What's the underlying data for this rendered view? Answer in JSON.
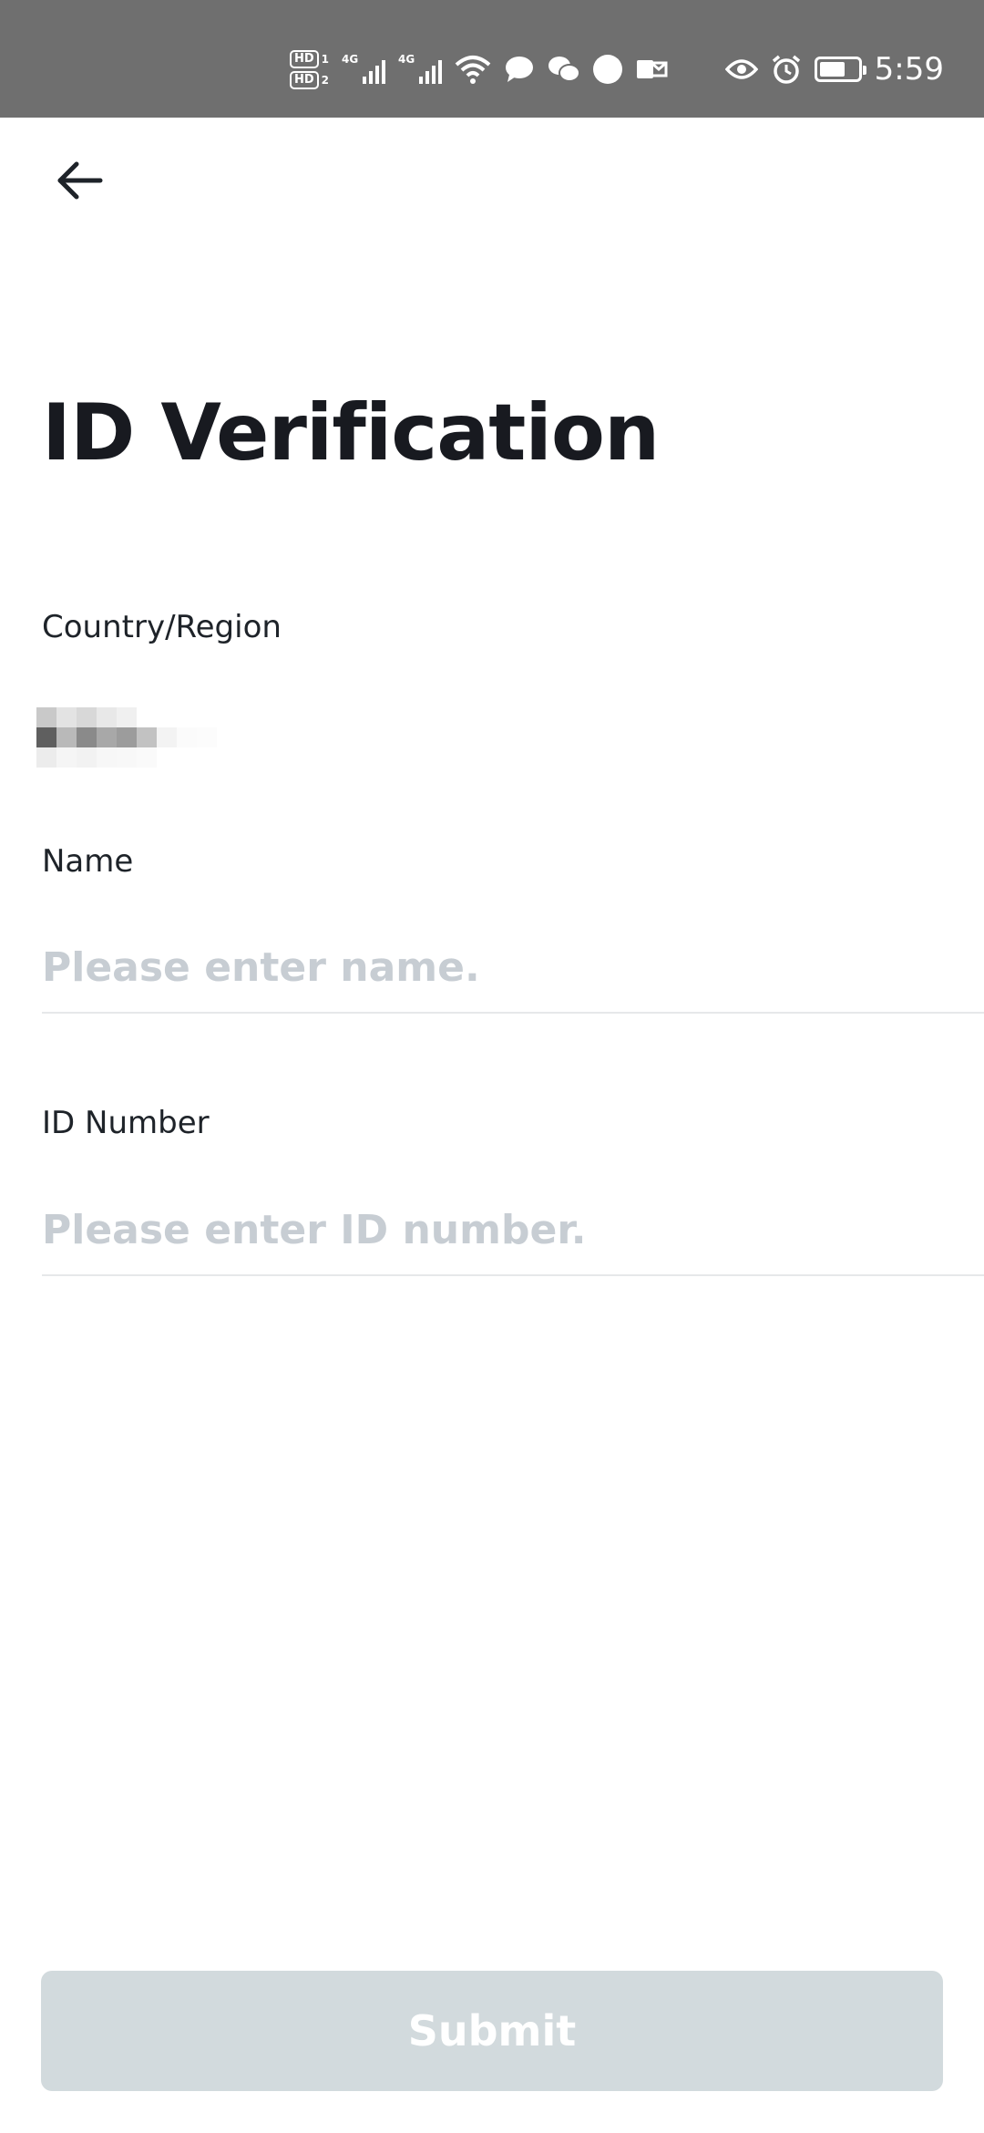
{
  "status_bar": {
    "hd1_label": "HD",
    "hd1_num": "1",
    "hd2_label": "HD",
    "hd2_num": "2",
    "sim1_type": "4G",
    "sim2_type": "4G",
    "time": "5:59"
  },
  "header": {
    "back_icon": "arrow-left-icon"
  },
  "page": {
    "title": "ID Verification"
  },
  "form": {
    "country_label": "Country/Region",
    "country_value_redacted": true,
    "name_label": "Name",
    "name_placeholder": "Please enter name.",
    "name_value": "",
    "id_label": "ID Number",
    "id_placeholder": "Please enter ID number.",
    "id_value": "",
    "submit_label": "Submit"
  },
  "colors": {
    "status_bar_bg": "#6f6f6f",
    "title": "#181a20",
    "placeholder": "#c7cdd3",
    "submit_disabled_bg": "#d2dadd"
  }
}
